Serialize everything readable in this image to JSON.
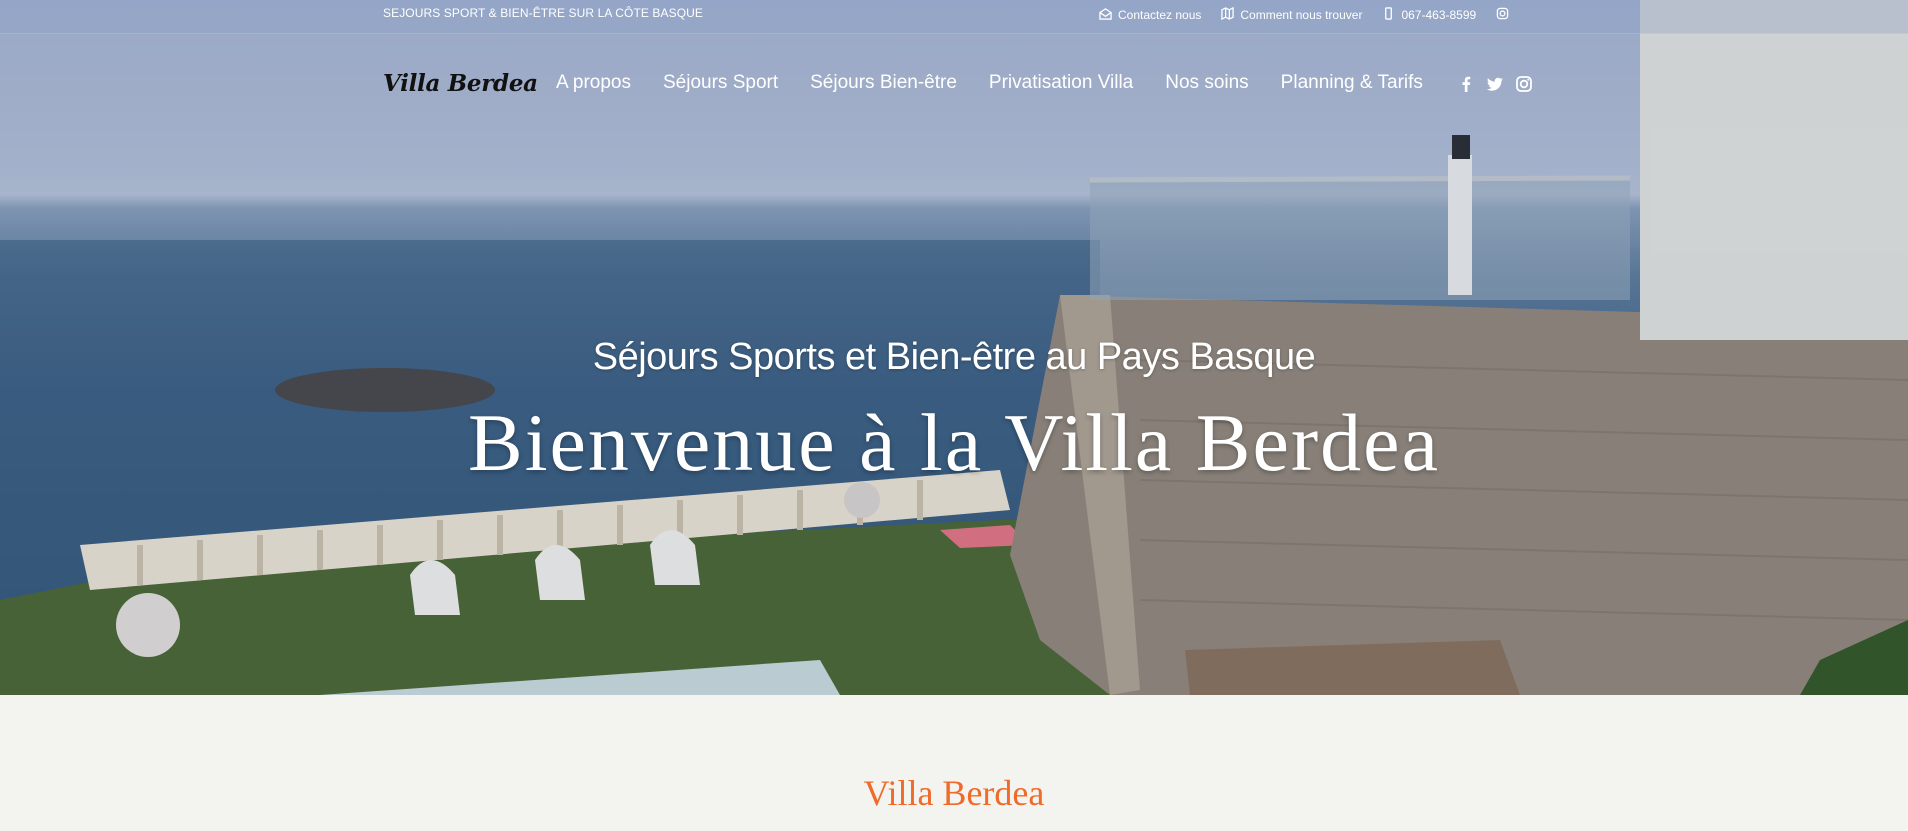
{
  "topbar": {
    "tagline": "SEJOURS SPORT & BIEN-ÊTRE SUR LA CÔTE BASQUE",
    "contact_label": "Contactez nous",
    "directions_label": "Comment nous trouver",
    "phone": "067-463-8599"
  },
  "nav": {
    "logo": "Villa Berdea",
    "items": [
      {
        "label": "A propos"
      },
      {
        "label": "Séjours Sport"
      },
      {
        "label": "Séjours Bien-être"
      },
      {
        "label": "Privatisation Villa"
      },
      {
        "label": "Nos soins"
      },
      {
        "label": "Planning & Tarifs"
      }
    ],
    "social_icons": [
      "facebook-icon",
      "twitter-icon",
      "instagram-icon"
    ]
  },
  "hero": {
    "subtitle": "Séjours Sports et Bien-être au Pays Basque",
    "headline": "Bienvenue à la Villa Berdea"
  },
  "section": {
    "title": "Villa Berdea"
  },
  "colors": {
    "accent": "#f06a2a",
    "page_background": "#f3f4ef"
  }
}
